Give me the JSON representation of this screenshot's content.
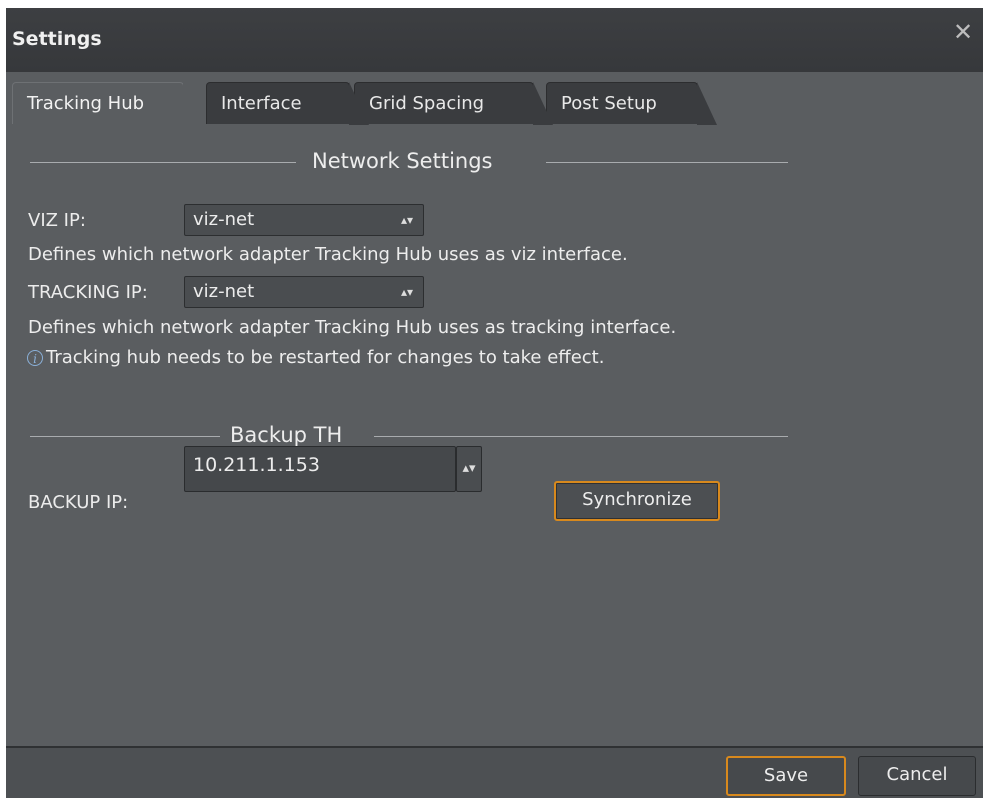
{
  "window": {
    "title": "Settings",
    "close_glyph": "✕"
  },
  "tabs": [
    {
      "label": "Tracking Hub",
      "active": true
    },
    {
      "label": "Interface",
      "active": false
    },
    {
      "label": "Grid Spacing",
      "active": false
    },
    {
      "label": "Post Setup",
      "active": false
    }
  ],
  "network": {
    "title": "Network Settings",
    "viz_ip_label": "VIZ IP:",
    "viz_ip_value": "viz-net",
    "viz_desc": "Defines which network adapter Tracking Hub uses as viz interface.",
    "tracking_ip_label": "TRACKING IP:",
    "tracking_ip_value": "viz-net",
    "tracking_desc": "Defines which network adapter Tracking Hub uses as tracking interface.",
    "restart_note": "Tracking hub needs to be restarted for changes to take effect."
  },
  "backup": {
    "title": "Backup TH",
    "backup_ip_label": "BACKUP IP:",
    "backup_ip_value": "10.211.1.153",
    "sync_label": "Synchronize"
  },
  "footer": {
    "save_label": "Save",
    "cancel_label": "Cancel"
  },
  "icons": {
    "select_arrows": "▲▼",
    "info": "i"
  },
  "colors": {
    "accent": "#d8891d",
    "panel": "#5a5d60",
    "titlebar": "#3a3c3f",
    "info_icon": "#8ab0d8"
  }
}
